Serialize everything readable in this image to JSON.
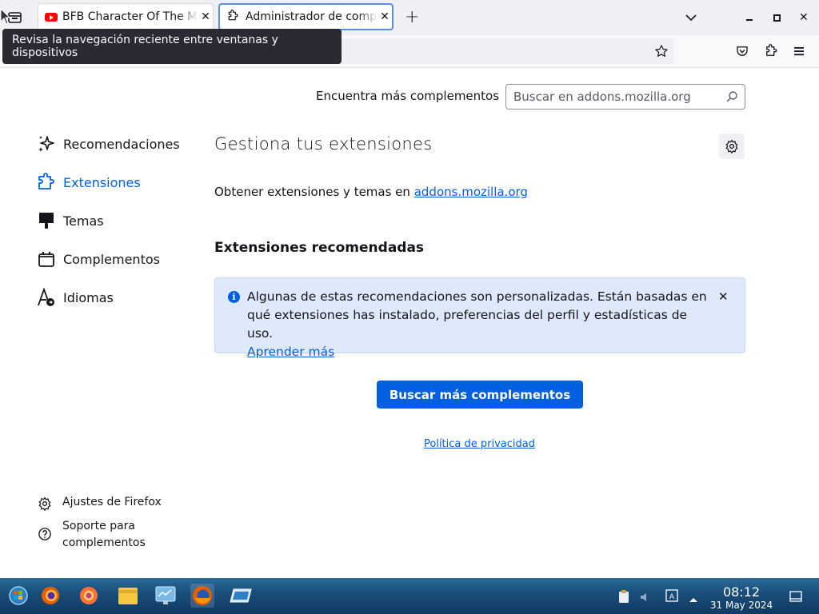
{
  "browser": {
    "tabs": [
      {
        "title": "BFB Character Of The Mo",
        "active": false
      },
      {
        "title": "Administrador de complementos",
        "active": true
      }
    ],
    "tooltip": "Revisa la navegación reciente entre ventanas y dispositivos",
    "new_tab_label": "+"
  },
  "header": {
    "find_more_label": "Encuentra más complementos",
    "search_placeholder": "Buscar en addons.mozilla.org"
  },
  "sidebar": {
    "items": [
      {
        "label": "Recomendaciones",
        "icon": "sparkle-icon",
        "selected": false
      },
      {
        "label": "Extensiones",
        "icon": "puzzle-icon",
        "selected": true
      },
      {
        "label": "Temas",
        "icon": "brush-icon",
        "selected": false
      },
      {
        "label": "Complementos",
        "icon": "plugin-icon",
        "selected": false
      },
      {
        "label": "Idiomas",
        "icon": "language-icon",
        "selected": false
      }
    ],
    "footer": {
      "settings_label": "Ajustes de Firefox",
      "support_label_line1": "Soporte para",
      "support_label_line2": "complementos"
    }
  },
  "main": {
    "title": "Gestiona tus extensiones",
    "obtain_prefix": "Obtener extensiones y temas en ",
    "obtain_link": "addons.mozilla.org",
    "recommended_heading": "Extensiones recomendadas",
    "info_text": "Algunas de estas recomendaciones son personalizadas. Están basadas en qué extensiones has instalado, preferencias del perfil y estadísticas de uso.",
    "info_link": "Aprender más",
    "find_more_button": "Buscar más complementos",
    "privacy_link": "Política de privacidad"
  },
  "taskbar": {
    "time": "08:12",
    "date": "31 May 2024"
  },
  "colors": {
    "accent": "#0060df",
    "info_bg": "#deeafc",
    "tooltip_bg": "#2b2a33",
    "tab_strip_bg": "#f0f0f4"
  }
}
